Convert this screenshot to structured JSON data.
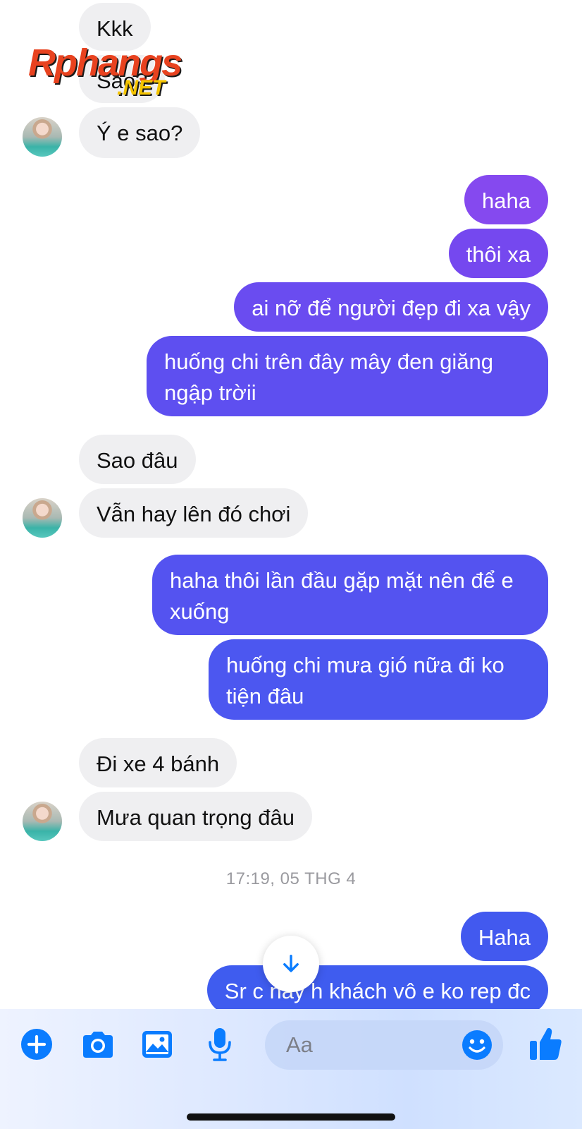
{
  "watermark": {
    "brand": "Rphangs",
    "suffix": ".NET"
  },
  "messages": {
    "m1": "Kkk",
    "m2": "Sao?",
    "m3": "Ý e sao?",
    "m4": "haha",
    "m5": "thôi xa",
    "m6": "ai nỡ để người đẹp đi xa vậy",
    "m7": "huống chi trên đây mây đen giăng ngập trờii",
    "m8": "Sao đâu",
    "m9": "Vẫn hay lên đó chơi",
    "m10": "haha thôi lần đầu gặp mặt nên để e xuống",
    "m11": "huống chi mưa gió nữa đi ko tiện đâu",
    "m12": "Đi xe 4 bánh",
    "m13": "Mưa quan trọng đâu",
    "m14": "Haha",
    "m15": "Sr c nãy h khách vô e ko rep đc"
  },
  "timestamp": "17:19, 05 THG 4",
  "composer": {
    "placeholder": "Aa",
    "icons": [
      "plus-icon",
      "camera-icon",
      "image-icon",
      "microphone-icon",
      "emoji-icon",
      "thumbs-up-icon"
    ]
  },
  "colors": {
    "accent": "#0a7cff",
    "outgoing_top": "#8a4bf0",
    "outgoing_bottom": "#3d5ff0",
    "incoming": "#efeff1"
  }
}
